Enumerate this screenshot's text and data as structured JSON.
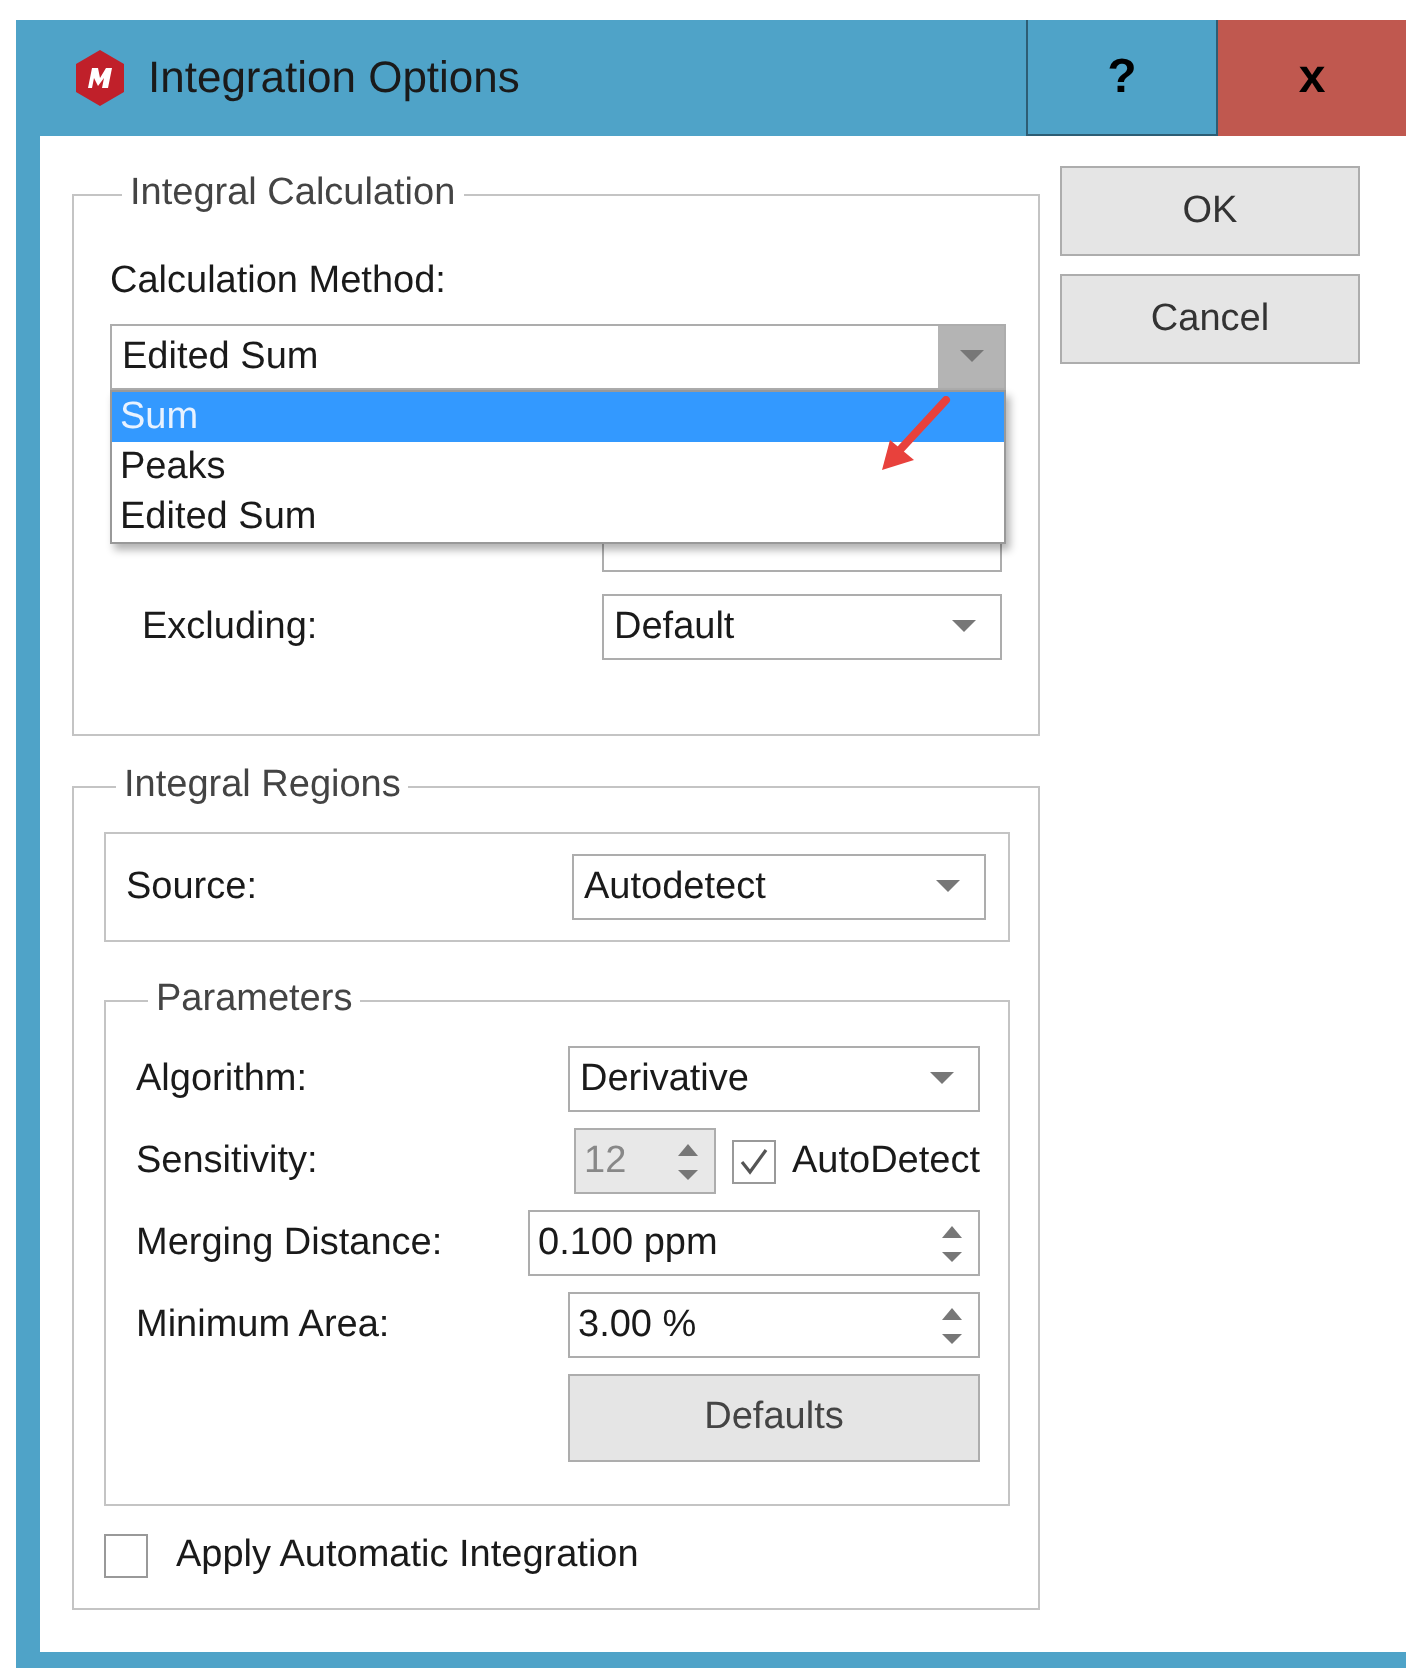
{
  "window": {
    "title": "Integration Options",
    "help_button": "?",
    "close_button": "x"
  },
  "integral_calculation": {
    "title": "Integral Calculation",
    "method_label": "Calculation Method:",
    "method_value": "Edited Sum",
    "method_options": [
      {
        "label": "Sum",
        "selected": true
      },
      {
        "label": "Peaks",
        "selected": false
      },
      {
        "label": "Edited Sum",
        "selected": false
      }
    ],
    "rows": [
      {
        "label": "Excluding:",
        "value": "Default"
      }
    ]
  },
  "dialog_buttons": [
    "OK",
    "Cancel"
  ],
  "integral_regions": {
    "title": "Integral Regions",
    "source": {
      "label": "Source:",
      "value": "Autodetect"
    },
    "parameters": {
      "title": "Parameters",
      "algorithm": {
        "label": "Algorithm:",
        "value": "Derivative"
      },
      "sensitivity": {
        "label": "Sensitivity:",
        "value": "12",
        "disabled": true,
        "auto_detect": {
          "label": "AutoDetect",
          "checked": true
        }
      },
      "merging_distance": {
        "label": "Merging Distance:",
        "value": "0.100 ppm"
      },
      "minimum_area": {
        "label": "Minimum Area:",
        "value": "3.00 %"
      },
      "defaults_button": "Defaults"
    },
    "apply_automatic": {
      "label": "Apply Automatic Integration",
      "checked": false
    }
  }
}
